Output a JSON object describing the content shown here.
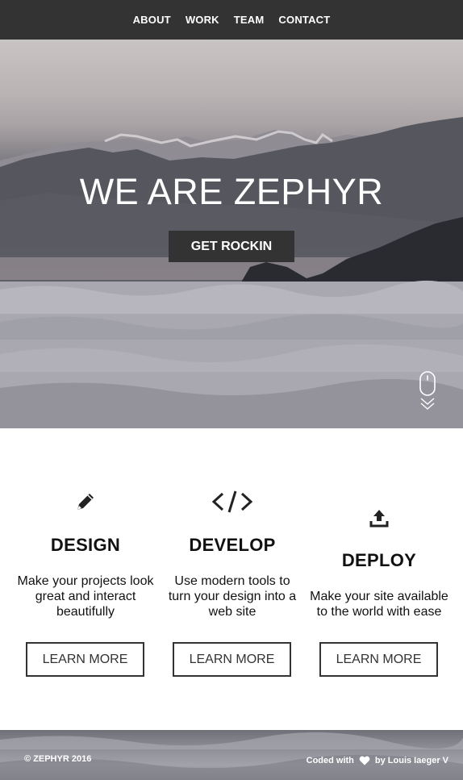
{
  "nav": {
    "items": [
      {
        "label": "ABOUT"
      },
      {
        "label": "WORK"
      },
      {
        "label": "TEAM"
      },
      {
        "label": "CONTACT"
      }
    ],
    "background": "#333333"
  },
  "hero": {
    "title": "WE ARE ZEPHYR",
    "button_label": "GET ROCKIN",
    "scroll_icon": "mouse-scroll-icon"
  },
  "features": [
    {
      "icon": "pencil-icon",
      "title": "DESIGN",
      "description_lines": [
        "Make your projects look",
        "great and interact",
        "beautifully"
      ],
      "button_label": "LEARN MORE"
    },
    {
      "icon": "code-icon",
      "title": "DEVELOP",
      "description_lines": [
        "Use modern tools to",
        "turn your design into a",
        "web site"
      ],
      "button_label": "LEARN MORE"
    },
    {
      "icon": "upload-icon",
      "title": "DEPLOY",
      "description_lines": [
        "Make your site available",
        "to the world with ease"
      ],
      "button_label": "LEARN MORE"
    }
  ],
  "footer": {
    "copyright": "© ZEPHYR 2016",
    "credit_prefix": "Coded with",
    "credit_icon": "heart-icon",
    "credit_suffix": "by Louis Iaeger V"
  }
}
